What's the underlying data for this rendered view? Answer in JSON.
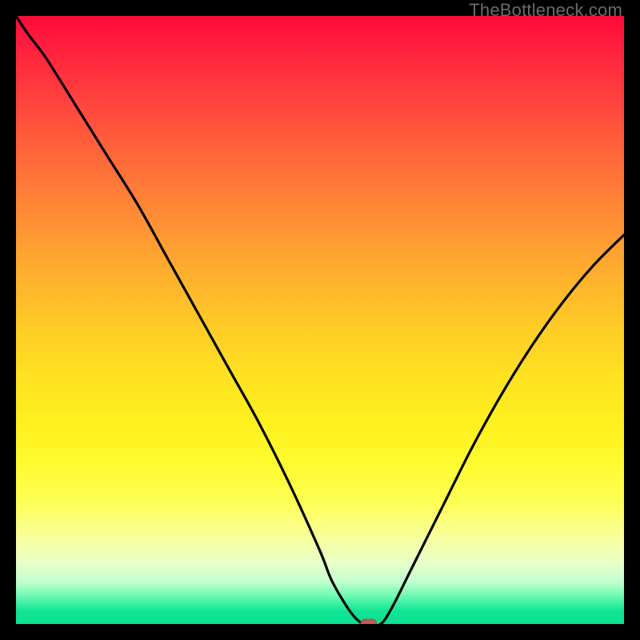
{
  "watermark": "TheBottleneck.com",
  "colors": {
    "frame": "#000000",
    "curve_stroke": "#000000",
    "marker_fill": "#c15a55",
    "marker_stroke": "#a84c48"
  },
  "chart_data": {
    "type": "line",
    "title": "",
    "xlabel": "",
    "ylabel": "",
    "xlim": [
      0,
      100
    ],
    "ylim": [
      0,
      100
    ],
    "grid": false,
    "legend": false,
    "x": [
      0,
      2,
      5,
      10,
      15,
      20,
      25,
      30,
      35,
      40,
      45,
      50,
      52,
      55,
      57,
      58,
      60,
      62,
      65,
      70,
      75,
      80,
      85,
      90,
      95,
      100
    ],
    "y": [
      100,
      97,
      93,
      85,
      77,
      69,
      60,
      51,
      42,
      33,
      23,
      12,
      7,
      2,
      0,
      0,
      0,
      3,
      9,
      19,
      29,
      38,
      46,
      53,
      59,
      64
    ],
    "marker": {
      "x": 58,
      "y": 0,
      "shape": "rounded-rect"
    },
    "annotations": []
  }
}
